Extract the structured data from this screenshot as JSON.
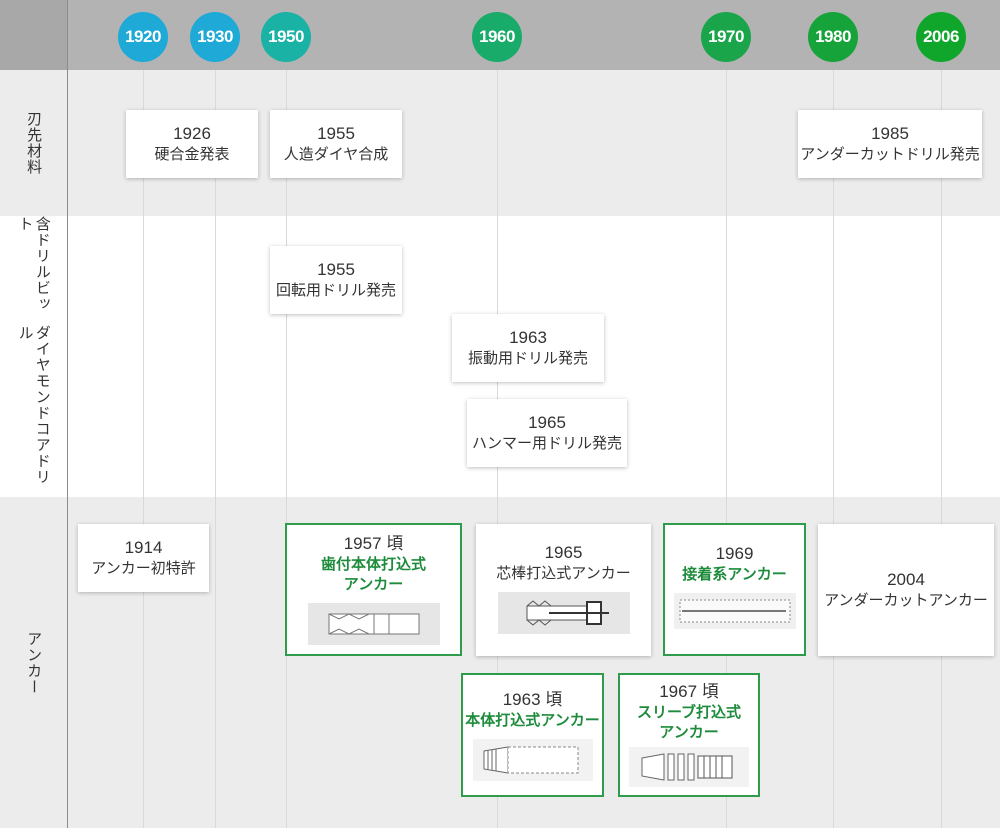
{
  "timeline": {
    "years": [
      {
        "label": "1920",
        "color": "#1ea9d6"
      },
      {
        "label": "1930",
        "color": "#1ea9d6"
      },
      {
        "label": "1950",
        "color": "#19b2a4"
      },
      {
        "label": "1960",
        "color": "#19ab6a"
      },
      {
        "label": "1970",
        "color": "#1ba54b"
      },
      {
        "label": "1980",
        "color": "#16a33a"
      },
      {
        "label": "2006",
        "color": "#10a62c"
      }
    ]
  },
  "rows": {
    "blade": {
      "label": "刃先材料"
    },
    "drill": {
      "label_line1": "ダイヤモンドコアドリル",
      "label_line2": "含ドリルビット"
    },
    "anchor": {
      "label": "アンカー"
    }
  },
  "events": {
    "e1926": {
      "year": "1926",
      "text": "硬合金発表"
    },
    "e1955a": {
      "year": "1955",
      "text": "人造ダイヤ合成"
    },
    "e1985": {
      "year": "1985",
      "text": "アンダーカットドリル発売"
    },
    "e1955b": {
      "year": "1955",
      "text": "回転用ドリル発売"
    },
    "e1963a": {
      "year": "1963",
      "text": "振動用ドリル発売"
    },
    "e1965a": {
      "year": "1965",
      "text": "ハンマー用ドリル発売"
    },
    "e1914": {
      "year": "1914",
      "text": "アンカー初特許"
    },
    "e1957": {
      "year": "1957 頃",
      "text1": "歯付本体打込式",
      "text2": "アンカー"
    },
    "e1965b": {
      "year": "1965",
      "text": "芯棒打込式アンカー"
    },
    "e1969": {
      "year": "1969",
      "text": "接着系アンカー"
    },
    "e2004": {
      "year": "2004",
      "text": "アンダーカットアンカー"
    },
    "e1963b": {
      "year": "1963 頃",
      "text": "本体打込式アンカー"
    },
    "e1967": {
      "year": "1967 頃",
      "text1": "スリーブ打込式",
      "text2": "アンカー"
    }
  },
  "colors": {
    "accent_green": "#2e9c4a",
    "header_gray": "#b3b3b3",
    "row_gray": "#ececec"
  }
}
